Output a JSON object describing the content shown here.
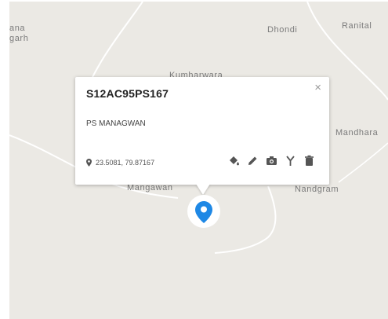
{
  "map": {
    "places": {
      "ana": "ana",
      "garh": "garh",
      "dhondi": "Dhondi",
      "ranital": "Ranital",
      "kumharwara": "Kumharwara",
      "mandhara": "Mandhara",
      "mangawan": "Mangawan",
      "nandgram": "Nandgram"
    }
  },
  "popup": {
    "title": "S12AC95PS167",
    "subtitle": "PS MANAGWAN",
    "coords": "23.5081, 79.87167",
    "close_symbol": "×",
    "actions": [
      "paint-bucket-icon",
      "pencil-icon",
      "camera-icon",
      "fork-icon",
      "trash-icon"
    ]
  },
  "marker": {
    "icon": "map-marker-icon",
    "color": "#1e88e5"
  },
  "colors": {
    "map_bg": "#ebe9e4",
    "road": "#ffffff",
    "icon": "#555555"
  }
}
